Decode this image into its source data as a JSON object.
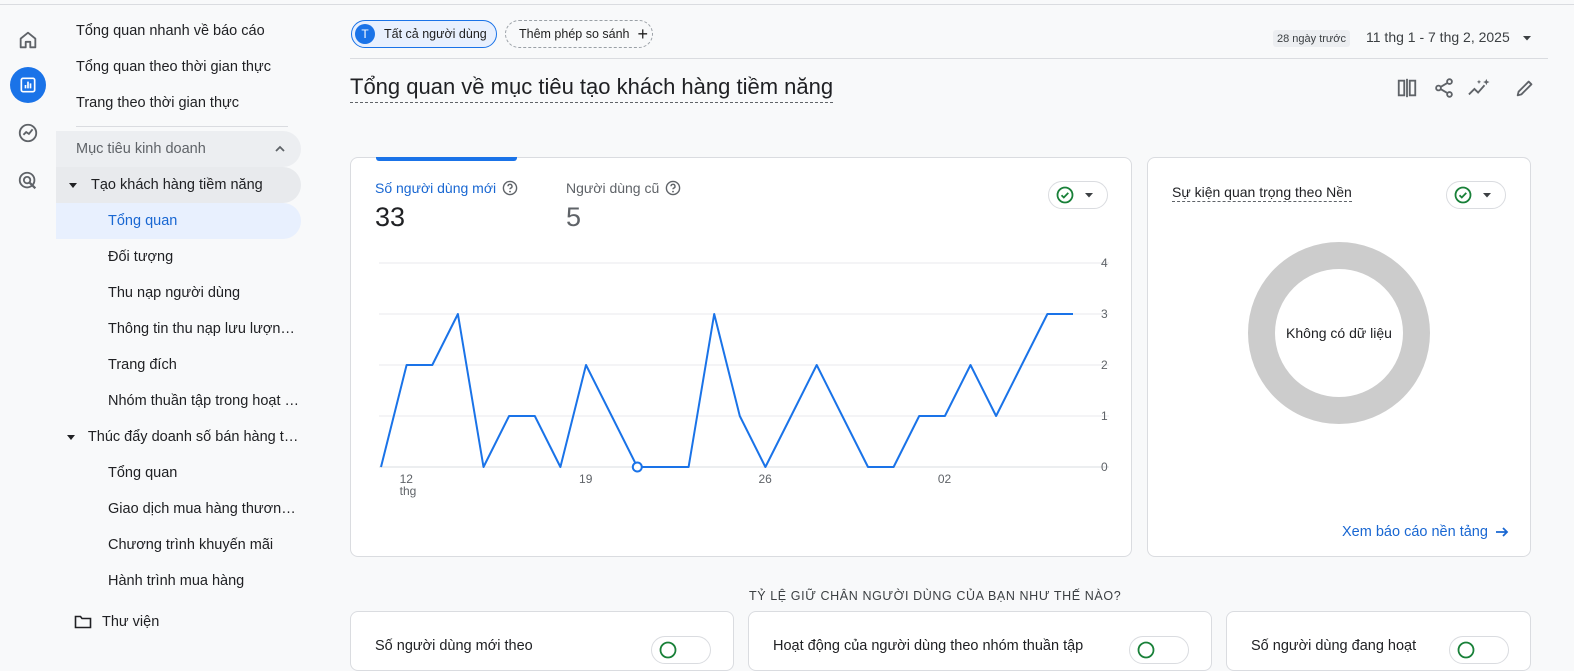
{
  "sidebar": {
    "items": [
      {
        "label": "Tổng quan nhanh về báo cáo"
      },
      {
        "label": "Tổng quan theo thời gian thực"
      },
      {
        "label": "Trang theo thời gian thực"
      },
      {
        "label": "Mục tiêu kinh doanh"
      },
      {
        "label": "Tạo khách hàng tiềm năng"
      },
      {
        "label": "Tổng quan"
      },
      {
        "label": "Đối tượng"
      },
      {
        "label": "Thu nạp người dùng"
      },
      {
        "label": "Thông tin thu nạp lưu lượng truy cập"
      },
      {
        "label": "Trang đích"
      },
      {
        "label": "Nhóm thuần tập trong hoạt động"
      },
      {
        "label": "Thúc đẩy doanh số bán hàng trực tuyến"
      },
      {
        "label": "Tổng quan"
      },
      {
        "label": "Giao dịch mua hàng thương mại"
      },
      {
        "label": "Chương trình khuyến mãi"
      },
      {
        "label": "Hành trình mua hàng"
      },
      {
        "label": "Thư viện"
      }
    ]
  },
  "header": {
    "segment_initial": "T",
    "segment_label": "Tất cả người dùng",
    "add_compare_label": "Thêm phép so sánh",
    "date_badge": "28 ngày trước",
    "date_range": "11 thg 1 - 7 thg 2, 2025",
    "page_title": "Tổng quan về mục tiêu tạo khách hàng tiềm năng"
  },
  "main_card": {
    "metric1_label": "Số người dùng mới",
    "metric1_value": "33",
    "metric2_label": "Người dùng cũ",
    "metric2_value": "5"
  },
  "chart_data": {
    "type": "line",
    "x": [
      "2025-01-11",
      "2025-01-12",
      "2025-01-13",
      "2025-01-14",
      "2025-01-15",
      "2025-01-16",
      "2025-01-17",
      "2025-01-18",
      "2025-01-19",
      "2025-01-20",
      "2025-01-21",
      "2025-01-22",
      "2025-01-23",
      "2025-01-24",
      "2025-01-25",
      "2025-01-26",
      "2025-01-27",
      "2025-01-28",
      "2025-01-29",
      "2025-01-30",
      "2025-01-31",
      "2025-02-01",
      "2025-02-02",
      "2025-02-03",
      "2025-02-04",
      "2025-02-05",
      "2025-02-06",
      "2025-02-07"
    ],
    "series": [
      {
        "values": [
          0,
          2,
          2,
          3,
          0,
          1,
          1,
          0,
          2,
          1,
          0,
          0,
          0,
          3,
          1,
          0,
          1,
          2,
          1,
          0,
          0,
          1,
          1,
          2,
          1,
          2,
          3,
          3
        ],
        "color": "#1a73e8"
      }
    ],
    "x_tick_labels": [
      "12",
      "19",
      "26",
      "02"
    ],
    "x_tick_sublabel": "thg",
    "y_ticks": [
      "0",
      "1",
      "2",
      "3",
      "4"
    ],
    "ylim": [
      0,
      4
    ],
    "grid": true,
    "highlighted_point": "2025-01-21"
  },
  "side_card": {
    "title": "Sự kiện quan trọng theo Nền",
    "empty_text": "Không có dữ liệu",
    "link_label": "Xem báo cáo nền tảng"
  },
  "retention": {
    "caption": "TỶ LỆ GIỮ CHÂN NGƯỜI DÙNG CỦA BẠN NHƯ THẾ NÀO?",
    "card1_title": "Số người dùng mới theo",
    "card2_title": "Hoạt động của người dùng theo nhóm thuần tập",
    "card3_title": "Số người dùng đang hoạt"
  },
  "colors": {
    "accent": "#1a73e8",
    "check_green": "#188038",
    "donut_gray": "#cccccc"
  }
}
